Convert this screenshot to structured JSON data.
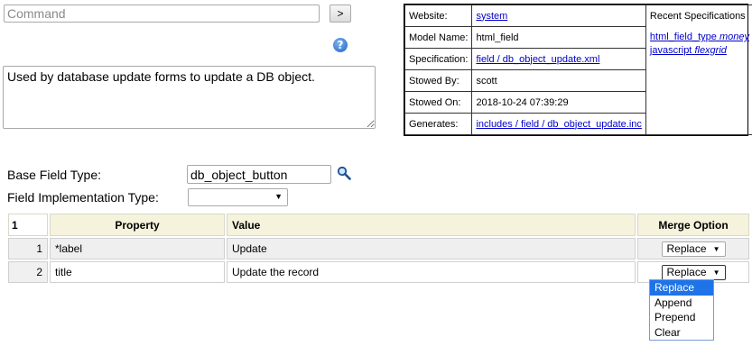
{
  "command": {
    "placeholder": "Command",
    "go_label": ">"
  },
  "help": {
    "label": "?"
  },
  "description": "Used by database update forms to update a DB object.",
  "info": {
    "rows": [
      {
        "key": "Website:",
        "value": "system",
        "link": true
      },
      {
        "key": "Model Name:",
        "value": "html_field",
        "link": false
      },
      {
        "key": "Specification:",
        "value": "field / db_object_update.xml",
        "link": true
      },
      {
        "key": "Stowed By:",
        "value": "scott",
        "link": false
      },
      {
        "key": "Stowed On:",
        "value": "2018-10-24 07:39:29",
        "link": false
      },
      {
        "key": "Generates:",
        "value": "includes / field / db_object_update.inc",
        "link": true
      }
    ],
    "recent_title": "Recent Specifications",
    "recent": [
      {
        "prefix": "html_field_type",
        "name": "money"
      },
      {
        "prefix": "javascript",
        "name": "flexgrid"
      }
    ]
  },
  "base_field_type": {
    "label": "Base Field Type:",
    "value": "db_object_button"
  },
  "field_impl_type": {
    "label": "Field Implementation Type:",
    "value": ""
  },
  "grid": {
    "count": "1",
    "headers": {
      "property": "Property",
      "value": "Value",
      "merge": "Merge Option"
    },
    "rows": [
      {
        "num": "1",
        "property": "*label",
        "value": "Update",
        "merge": "Replace"
      },
      {
        "num": "2",
        "property": "title",
        "value": "Update the record",
        "merge": "Replace"
      }
    ]
  },
  "merge_options": [
    "Replace",
    "Append",
    "Prepend",
    "Clear"
  ],
  "merge_selected": "Replace"
}
